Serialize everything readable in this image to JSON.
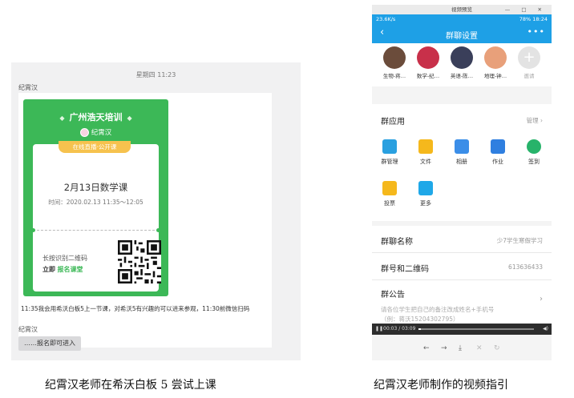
{
  "chat": {
    "timestamp": "星期四 11:23",
    "sender": "纪霄汉",
    "poster": {
      "org": "广州浩天培训",
      "host": "纪霄汉",
      "tag": "在线直播·公开课",
      "title": "2月13日数学课",
      "time": "时间：2020.02.13 11:35～12:05",
      "scan_line1": "长按识别二维码",
      "scan_prefix": "立即",
      "scan_action": "报名课堂"
    },
    "message": "11:35我会用希沃白板5上一节课，对希沃5有兴趣的可以进来参观，11:30前微信扫码",
    "sender2": "纪霄汉",
    "reply": "……报名即可进入"
  },
  "video": {
    "window_title": "视频预览",
    "window_controls": "— □ ✕",
    "status_left": "23.6K/s",
    "status_right": "78% 18:24",
    "app_title": "群聊设置",
    "members": [
      {
        "label": "生物-蒋…",
        "color": "#6b4c3b"
      },
      {
        "label": "数学-纪…",
        "color": "#c8304a"
      },
      {
        "label": "英语-陈…",
        "color": "#3a3f5a"
      },
      {
        "label": "地理-钟…",
        "color": "#e8a07a"
      }
    ],
    "invite_label": "邀请",
    "apps_header": "群应用",
    "manage_label": "管理",
    "apps": [
      {
        "label": "群管理",
        "color": "#2aa0e0"
      },
      {
        "label": "文件",
        "color": "#f5b81c"
      },
      {
        "label": "相册",
        "color": "#3b8ee8"
      },
      {
        "label": "作业",
        "color": "#2f7fe0"
      },
      {
        "label": "签到",
        "color": "#27b36a"
      },
      {
        "label": "投票",
        "color": "#f5b81c"
      },
      {
        "label": "更多",
        "color": "#1fa8e8"
      }
    ],
    "group_name_label": "群聊名称",
    "group_name_value": "少7学生寒假学习",
    "group_id_label": "群号和二维码",
    "group_id_value": "613636433",
    "notice_label": "群公告",
    "notice_hint1": "请各位学生把自己的备注改成姓名+手机号",
    "notice_hint2": "（例：蒋沃15204302795）",
    "player_time": "00:03 / 03:09",
    "player_progress": 0.02
  },
  "captions": {
    "left": "纪霄汉老师在希沃白板 5 尝试上课",
    "right": "纪霄汉老师制作的视频指引"
  },
  "colors": {
    "brand_green": "#3cb857",
    "qq_blue": "#1ea0e6"
  }
}
